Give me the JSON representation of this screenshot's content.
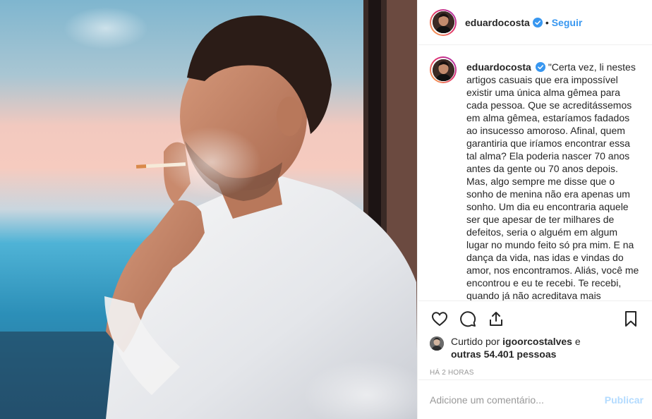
{
  "post": {
    "username": "eduardocosta",
    "separator": "•",
    "follow_label": "Seguir"
  },
  "caption": {
    "username": "eduardocosta",
    "text": "\"Certa vez, li nestes artigos casuais que era impossível existir uma única alma gêmea para cada pessoa. Que se acreditássemos em alma gêmea, estaríamos fadados ao insucesso amoroso. Afinal, quem garantiria que iríamos encontrar essa tal alma? Ela poderia nascer 70 anos antes da gente ou 70 anos depois. Mas, algo sempre me disse que o sonho de menina não era apenas um sonho. Um dia eu encontraria aquele ser que apesar de ter milhares de defeitos, seria o alguém em algum lugar no mundo feito só pra mim. E na dança da vida, nas idas e vindas do amor, nos encontramos. Aliás, você me encontrou e eu te recebi. Te recebi, quando já não acreditava mais"
  },
  "likes": {
    "prefix": "Curtido por",
    "user": "igoorcostalves",
    "conjunction": "e",
    "others": "outras 54.401 pessoas"
  },
  "timestamp": "HÁ 2 HORAS",
  "comment": {
    "placeholder": "Adicione um comentário...",
    "post_label": "Publicar"
  },
  "colors": {
    "accent": "#3897f0",
    "verified": "#3897f0",
    "post_disabled": "#b3dbff"
  },
  "icons": {
    "like": "heart-icon",
    "comment": "comment-icon",
    "share": "share-icon",
    "save": "bookmark-icon",
    "verified": "verified-badge-icon"
  }
}
